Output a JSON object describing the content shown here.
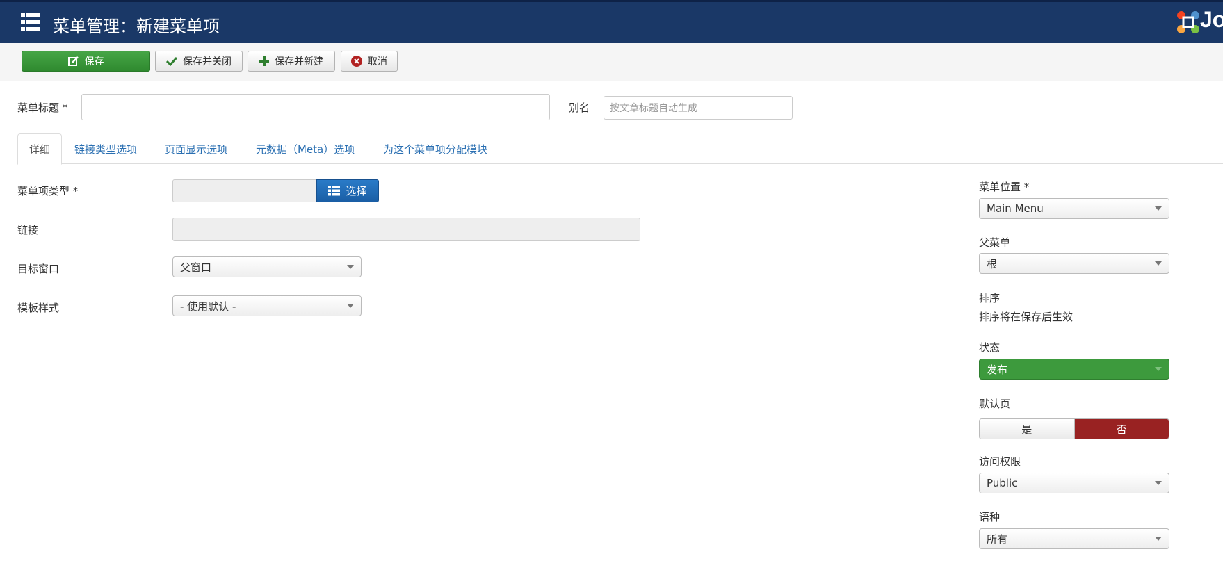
{
  "header": {
    "title": "菜单管理：新建菜单项",
    "logo_text": "Jo"
  },
  "toolbar": {
    "save_label": "保存",
    "save_close_label": "保存并关闭",
    "save_new_label": "保存并新建",
    "cancel_label": "取消"
  },
  "title_row": {
    "menu_title_label": "菜单标题 *",
    "menu_title_value": "",
    "alias_label": "别名",
    "alias_placeholder": "按文章标题自动生成"
  },
  "tabs": [
    {
      "label": "详细",
      "active": true
    },
    {
      "label": "链接类型选项"
    },
    {
      "label": "页面显示选项"
    },
    {
      "label": "元数据（Meta）选项"
    },
    {
      "label": "为这个菜单项分配模块"
    }
  ],
  "details": {
    "item_type_label": "菜单项类型 *",
    "item_type_value": "",
    "choose_button": "选择",
    "link_label": "链接",
    "link_value": "",
    "target_window_label": "目标窗口",
    "target_window_value": "父窗口",
    "template_style_label": "模板样式",
    "template_style_value": "- 使用默认 -"
  },
  "sidebar": {
    "menu_position_label": "菜单位置 *",
    "menu_position_value": "Main Menu",
    "parent_label": "父菜单",
    "parent_value": "根",
    "ordering_label": "排序",
    "ordering_note": "排序将在保存后生效",
    "status_label": "状态",
    "status_value": "发布",
    "default_page_label": "默认页",
    "default_yes": "是",
    "default_no": "否",
    "default_selected": "否",
    "access_label": "访问权限",
    "access_value": "Public",
    "language_label": "语种",
    "language_value": "所有"
  },
  "colors": {
    "header_bg": "#1a3867",
    "save_green": "#3d9a3d",
    "primary_blue": "#1a5ea5",
    "danger_red": "#992222",
    "link_blue": "#2a6fb2"
  }
}
